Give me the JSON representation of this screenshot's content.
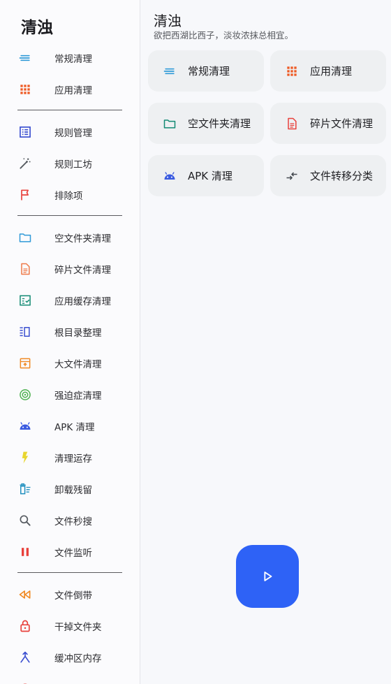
{
  "drawer": {
    "title": "清浊",
    "groups": [
      [
        {
          "label": "常规清理",
          "icon": "lines-icon",
          "color": "#2f9ad8"
        },
        {
          "label": "应用清理",
          "icon": "grid-icon",
          "color": "#ee5a24"
        }
      ],
      [
        {
          "label": "规则管理",
          "icon": "list-box-icon",
          "color": "#3b4fd0"
        },
        {
          "label": "规则工坊",
          "icon": "magic-wand-icon",
          "color": "#555a60"
        },
        {
          "label": "排除项",
          "icon": "flag-icon",
          "color": "#e8413c"
        }
      ],
      [
        {
          "label": "空文件夹清理",
          "icon": "folder-icon",
          "color": "#2f9ad8"
        },
        {
          "label": "碎片文件清理",
          "icon": "document-icon",
          "color": "#ee7a4a"
        },
        {
          "label": "应用缓存清理",
          "icon": "checklist-icon",
          "color": "#138a74"
        },
        {
          "label": "根目录整理",
          "icon": "columns-icon",
          "color": "#3b4fd0"
        },
        {
          "label": "大文件清理",
          "icon": "archive-icon",
          "color": "#f08a24"
        },
        {
          "label": "强迫症清理",
          "icon": "target-icon",
          "color": "#4cb04f"
        },
        {
          "label": "APK 清理",
          "icon": "android-icon",
          "color": "#3b5be0"
        },
        {
          "label": "清理运存",
          "icon": "flash-icon",
          "color": "#e8d630"
        },
        {
          "label": "卸载残留",
          "icon": "trash-list-icon",
          "color": "#1f8fbf"
        },
        {
          "label": "文件秒搜",
          "icon": "search-icon",
          "color": "#555a60"
        },
        {
          "label": "文件监听",
          "icon": "pause-icon",
          "color": "#e8413c"
        }
      ],
      [
        {
          "label": "文件倒带",
          "icon": "rewind-icon",
          "color": "#f08a24"
        },
        {
          "label": "干掉文件夹",
          "icon": "lock-icon",
          "color": "#e8413c"
        },
        {
          "label": "缓冲区内存",
          "icon": "merge-icon",
          "color": "#3b4fd0"
        },
        {
          "label": "",
          "icon": "circle-icon",
          "color": "#e8413c"
        }
      ]
    ]
  },
  "main": {
    "title": "清浊",
    "subtitle": "欲把西湖比西子，淡妆浓抹总相宜。",
    "cards": [
      {
        "label": "常规清理",
        "icon": "lines-icon",
        "color": "#2f9ad8"
      },
      {
        "label": "应用清理",
        "icon": "grid-icon",
        "color": "#ee5a24"
      },
      {
        "label": "空文件夹清理",
        "icon": "folder-icon",
        "color": "#138a74"
      },
      {
        "label": "碎片文件清理",
        "icon": "document-icon",
        "color": "#e8413c"
      },
      {
        "label": "APK 清理",
        "icon": "android-icon",
        "color": "#3b5be0"
      },
      {
        "label": "文件转移分类",
        "icon": "transfer-icon",
        "color": "#444a50"
      }
    ]
  },
  "fab": {
    "icon": "play-icon",
    "color": "#2e62f6"
  }
}
